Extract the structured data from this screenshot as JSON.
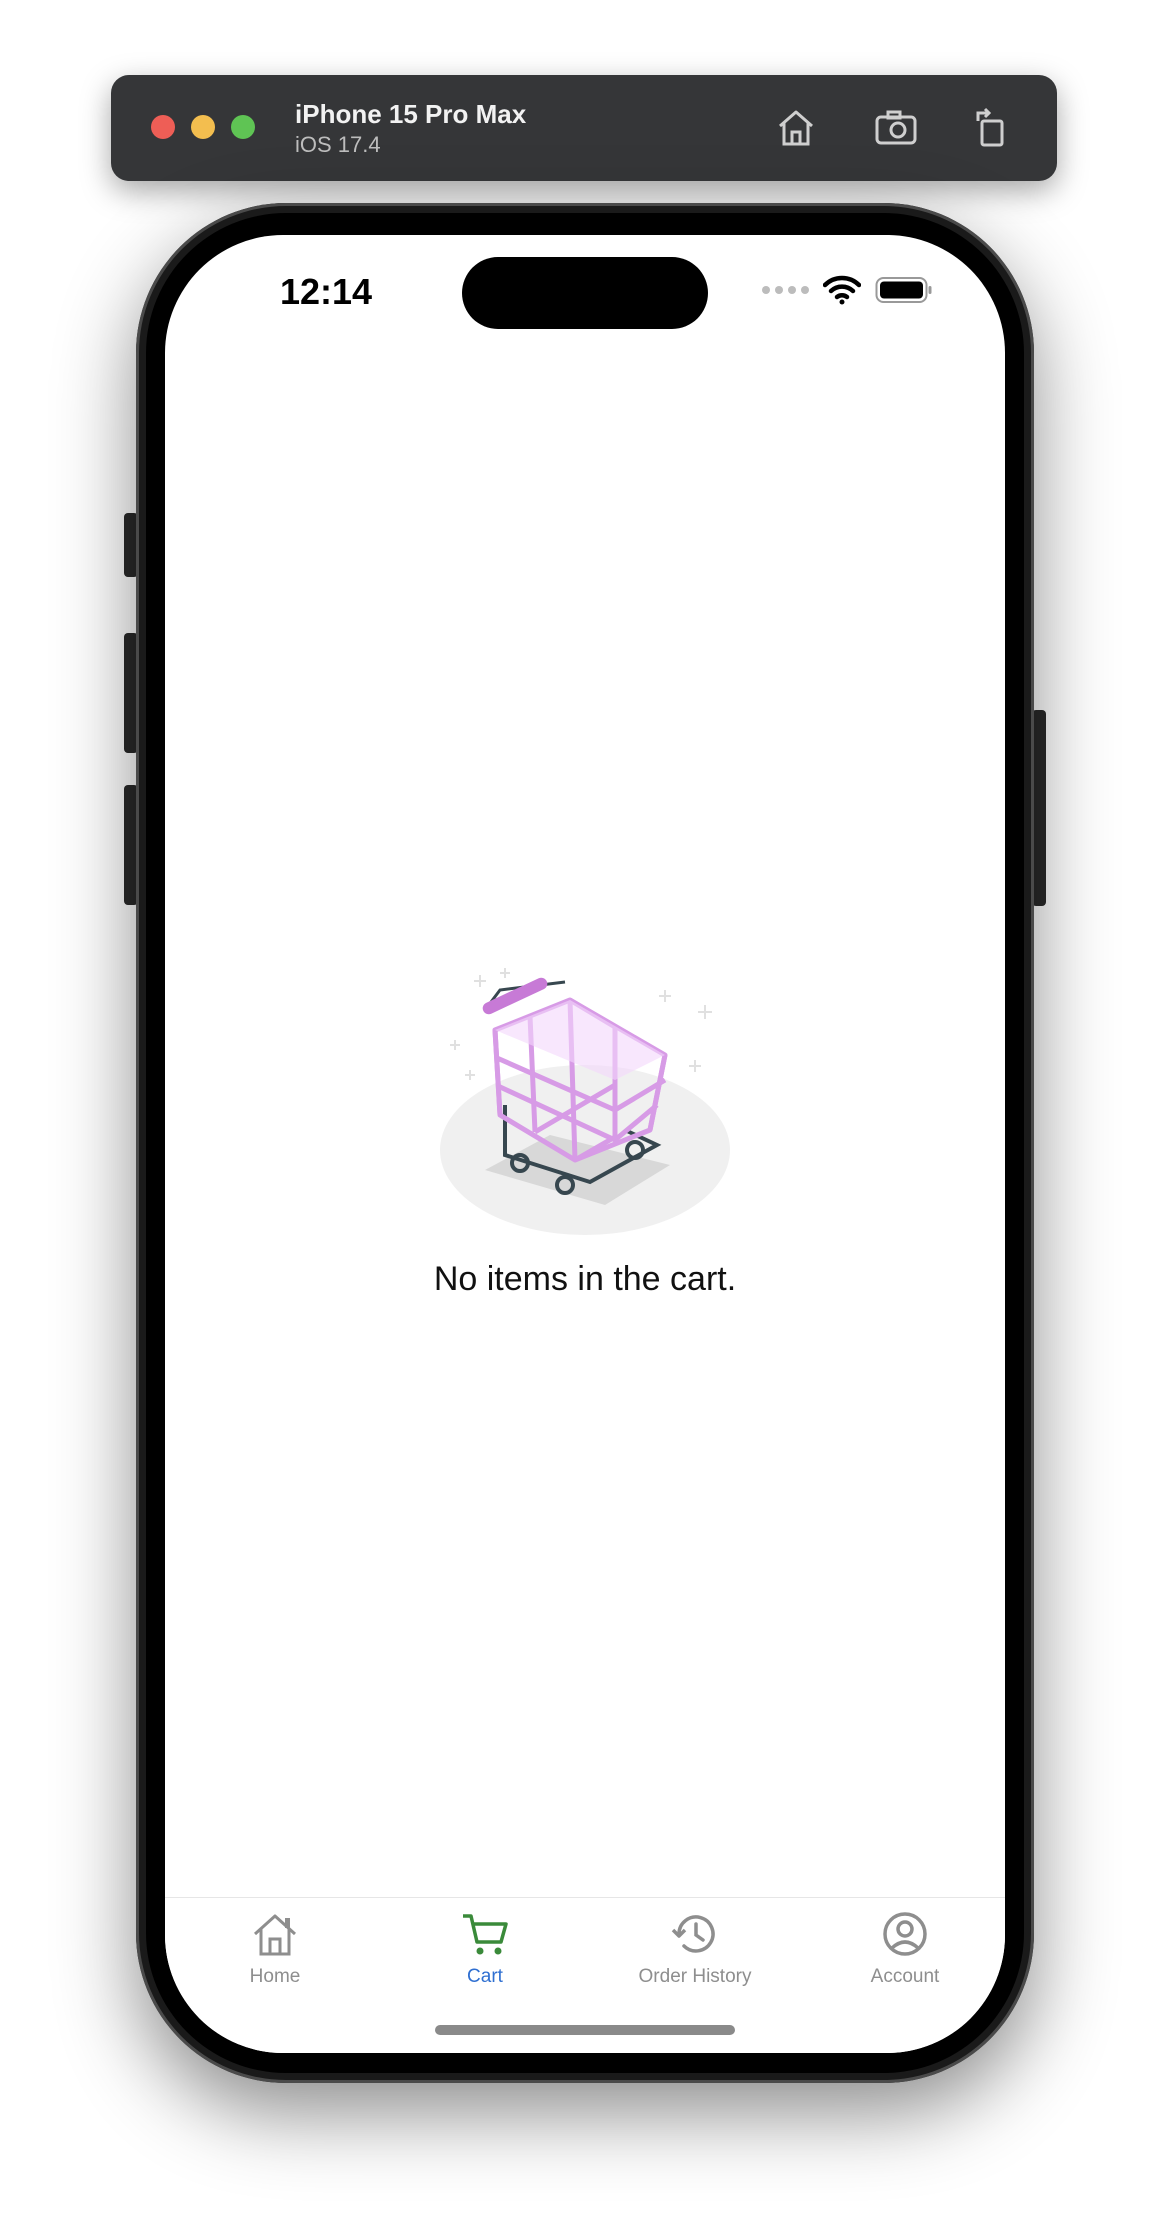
{
  "simulator": {
    "device_name": "iPhone 15 Pro Max",
    "os_version": "iOS 17.4",
    "buttons": [
      "home-icon",
      "screenshot-icon",
      "rotate-icon"
    ]
  },
  "status_bar": {
    "time": "12:14",
    "icons": [
      "signal-dots-icon",
      "wifi-icon",
      "battery-icon"
    ]
  },
  "cart": {
    "empty_message": "No items in the cart.",
    "illustration": "shopping-cart-illustration"
  },
  "tabs": [
    {
      "label": "Home",
      "icon": "home-icon",
      "active": false
    },
    {
      "label": "Cart",
      "icon": "cart-icon",
      "active": true
    },
    {
      "label": "Order History",
      "icon": "history-icon",
      "active": false
    },
    {
      "label": "Account",
      "icon": "account-icon",
      "active": false
    }
  ],
  "colors": {
    "active_tab_icon": "#3a8a3a",
    "active_tab_label": "#2f6fd1",
    "inactive": "#8e8e8e",
    "cart_basket": "#d79be6"
  }
}
